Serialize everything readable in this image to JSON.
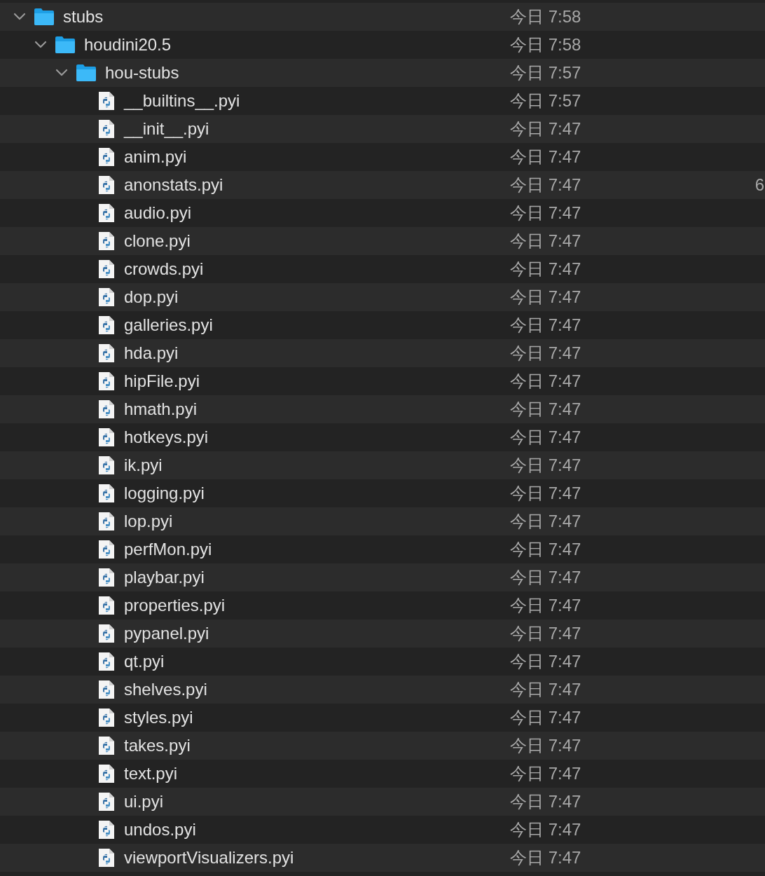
{
  "tree": [
    {
      "kind": "folder",
      "name": "stubs",
      "date": "今日 7:58",
      "expanded": true,
      "children": [
        {
          "kind": "folder",
          "name": "houdini20.5",
          "date": "今日 7:58",
          "expanded": true,
          "children": [
            {
              "kind": "folder",
              "name": "hou-stubs",
              "date": "今日 7:57",
              "expanded": true,
              "children": [
                {
                  "kind": "file",
                  "name": "__builtins__.pyi",
                  "date": "今日 7:57"
                },
                {
                  "kind": "file",
                  "name": "__init__.pyi",
                  "date": "今日 7:47"
                },
                {
                  "kind": "file",
                  "name": "anim.pyi",
                  "date": "今日 7:47"
                },
                {
                  "kind": "file",
                  "name": "anonstats.pyi",
                  "date": "今日 7:47",
                  "column_3": "6"
                },
                {
                  "kind": "file",
                  "name": "audio.pyi",
                  "date": "今日 7:47"
                },
                {
                  "kind": "file",
                  "name": "clone.pyi",
                  "date": "今日 7:47"
                },
                {
                  "kind": "file",
                  "name": "crowds.pyi",
                  "date": "今日 7:47"
                },
                {
                  "kind": "file",
                  "name": "dop.pyi",
                  "date": "今日 7:47"
                },
                {
                  "kind": "file",
                  "name": "galleries.pyi",
                  "date": "今日 7:47"
                },
                {
                  "kind": "file",
                  "name": "hda.pyi",
                  "date": "今日 7:47"
                },
                {
                  "kind": "file",
                  "name": "hipFile.pyi",
                  "date": "今日 7:47"
                },
                {
                  "kind": "file",
                  "name": "hmath.pyi",
                  "date": "今日 7:47"
                },
                {
                  "kind": "file",
                  "name": "hotkeys.pyi",
                  "date": "今日 7:47"
                },
                {
                  "kind": "file",
                  "name": "ik.pyi",
                  "date": "今日 7:47"
                },
                {
                  "kind": "file",
                  "name": "logging.pyi",
                  "date": "今日 7:47"
                },
                {
                  "kind": "file",
                  "name": "lop.pyi",
                  "date": "今日 7:47"
                },
                {
                  "kind": "file",
                  "name": "perfMon.pyi",
                  "date": "今日 7:47"
                },
                {
                  "kind": "file",
                  "name": "playbar.pyi",
                  "date": "今日 7:47"
                },
                {
                  "kind": "file",
                  "name": "properties.pyi",
                  "date": "今日 7:47"
                },
                {
                  "kind": "file",
                  "name": "pypanel.pyi",
                  "date": "今日 7:47"
                },
                {
                  "kind": "file",
                  "name": "qt.pyi",
                  "date": "今日 7:47"
                },
                {
                  "kind": "file",
                  "name": "shelves.pyi",
                  "date": "今日 7:47"
                },
                {
                  "kind": "file",
                  "name": "styles.pyi",
                  "date": "今日 7:47"
                },
                {
                  "kind": "file",
                  "name": "takes.pyi",
                  "date": "今日 7:47"
                },
                {
                  "kind": "file",
                  "name": "text.pyi",
                  "date": "今日 7:47"
                },
                {
                  "kind": "file",
                  "name": "ui.pyi",
                  "date": "今日 7:47"
                },
                {
                  "kind": "file",
                  "name": "undos.pyi",
                  "date": "今日 7:47"
                },
                {
                  "kind": "file",
                  "name": "viewportVisualizers.pyi",
                  "date": "今日 7:47"
                }
              ]
            }
          ]
        }
      ]
    }
  ]
}
